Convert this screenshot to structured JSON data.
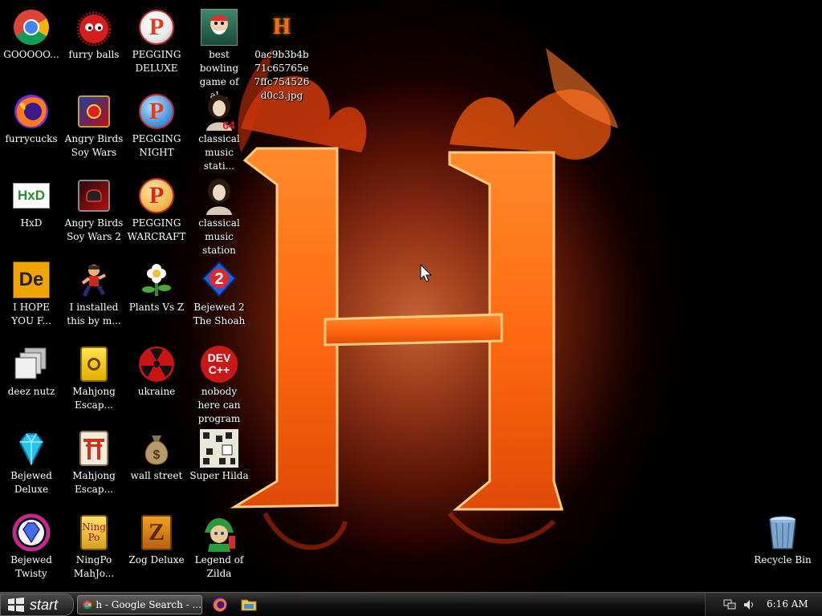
{
  "desktop": {
    "icons": {
      "chrome": "GOOOOO...",
      "furry_balls": "furry balls",
      "pegging_deluxe": "PEGGING DELUXE",
      "bowling": "best bowling game of al...",
      "jpg_file": "0ac9b3b4b71c65765e7ffc754526d0c3.jpg",
      "firefox": "furrycucks",
      "angry_birds_soy_wars": "Angry Birds Soy Wars",
      "pegging_night": "PEGGING NIGHT",
      "classical_1": "classical music stati...",
      "hxd": "HxD",
      "angry_birds_soy_wars_2": "Angry Birds Soy Wars 2",
      "pegging_warcraft": "PEGGING WARCRAFT",
      "classical_2": "classical music station",
      "i_hope": "I HOPE YOU F...",
      "i_installed": "I installed this by m...",
      "plants_vs_z": "Plants Vs Z",
      "bejewed_2": "Bejewed 2 The Shoah",
      "deez_nutz": "deez nutz",
      "mahjong_1": "Mahjong Escap...",
      "ukraine": "ukraine",
      "nobody_here": "nobody here can program",
      "bejewed_deluxe": "Bejewed Deluxe",
      "mahjong_2": "Mahjong Escap...",
      "wall_street": "wall street",
      "super_hilda": "Super Hilda",
      "bejewed_twisty": "Bejewed Twisty",
      "ningpo": "NingPo MahJo...",
      "zog_deluxe": "Zog Deluxe",
      "legend_of_zilda": "Legend of Zilda",
      "recycle_bin": "Recycle Bin"
    },
    "glyph_text": {
      "h_small": "H",
      "pegging": "P",
      "sixty_four": "64",
      "hxd": "HxD",
      "de": "De",
      "two": "2",
      "dev": "DEV",
      "cpp": "C++",
      "ningpo_1": "Ning",
      "ningpo_2": "Po",
      "money": "$",
      "zog": "Z"
    }
  },
  "taskbar": {
    "start_label": "start",
    "active_task": "h - Google Search - ...",
    "clock": "6:16 AM"
  }
}
